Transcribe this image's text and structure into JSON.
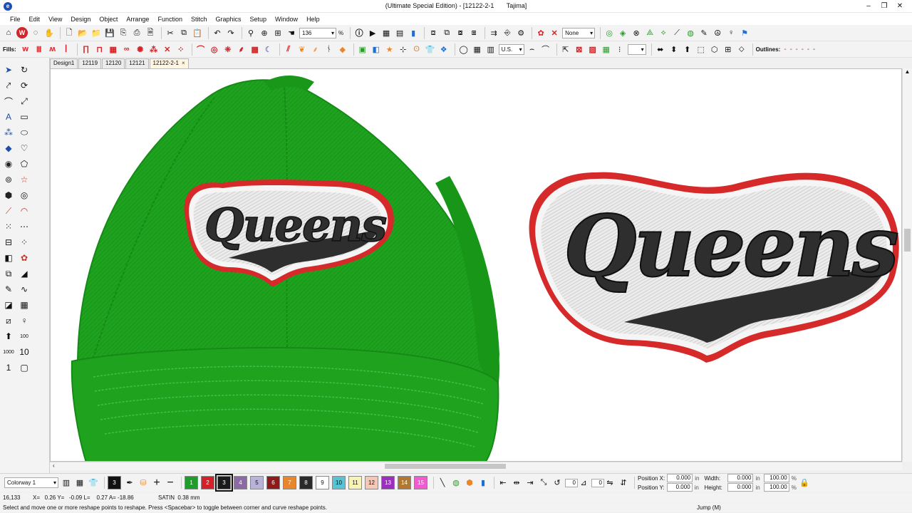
{
  "window": {
    "title": "(Ultimate Special Edition) - [12122-2-1       Tajima]",
    "app_icon": "wilcom-logo-icon"
  },
  "menu": [
    "File",
    "Edit",
    "View",
    "Design",
    "Object",
    "Arrange",
    "Function",
    "Stitch",
    "Graphics",
    "Setup",
    "Window",
    "Help"
  ],
  "toolbar1": {
    "zoom_value": "136",
    "zoom_unit": "%",
    "none_select": "None"
  },
  "toolbar2": {
    "fills_label": "Fills:",
    "units_select": "U.S.",
    "outlines_label": "Outlines:"
  },
  "tabs": [
    {
      "label": "Design1"
    },
    {
      "label": "12119"
    },
    {
      "label": "12120"
    },
    {
      "label": "12121"
    },
    {
      "label": "12122-2-1",
      "active": true
    }
  ],
  "canvas": {
    "cap_color": "#1fa31f",
    "cap_dark": "#168a17",
    "patch_text": "Queens",
    "patch_outline": "#d62a2a",
    "patch_fill": "#ebebeb",
    "letter_color": "#2e2e2e"
  },
  "bottom": {
    "colorway": "Colorway 1",
    "current_color": "3",
    "colors": [
      {
        "n": "1",
        "hex": "#1f9d2a"
      },
      {
        "n": "2",
        "hex": "#d42026"
      },
      {
        "n": "3",
        "hex": "#1a1a1a"
      },
      {
        "n": "4",
        "hex": "#8c6aa8"
      },
      {
        "n": "5",
        "hex": "#b9b3d9"
      },
      {
        "n": "6",
        "hex": "#8f1a1a"
      },
      {
        "n": "7",
        "hex": "#e9862a"
      },
      {
        "n": "8",
        "hex": "#2a2a2a"
      },
      {
        "n": "9",
        "hex": "#ffffff"
      },
      {
        "n": "10",
        "hex": "#56c4d4"
      },
      {
        "n": "11",
        "hex": "#f7f2b6"
      },
      {
        "n": "12",
        "hex": "#f7c7b6"
      },
      {
        "n": "13",
        "hex": "#9c2fbf"
      },
      {
        "n": "14",
        "hex": "#b3782f"
      },
      {
        "n": "15",
        "hex": "#f05bd0"
      }
    ],
    "position_x_label": "Position X:",
    "position_y_label": "Position Y:",
    "width_label": "Width:",
    "height_label": "Height:",
    "pos_x": "0.000",
    "pos_y": "0.000",
    "width": "0.000",
    "height": "0.000",
    "unit": "in",
    "pct_w": "100.00",
    "pct_h": "100.00",
    "pct_unit": "%",
    "rotate_value": "0"
  },
  "status": {
    "stitch_count": "16,133",
    "coords": "X=   0.26 Y=   -0.09 L=    0.27 A= -18.86",
    "stitch_type": "SATIN  0.38 mm",
    "hint": "Select and move one or more reshape points to reshape. Press <Spacebar> to toggle between corner and curve reshape points.",
    "jump": "Jump (M)"
  }
}
